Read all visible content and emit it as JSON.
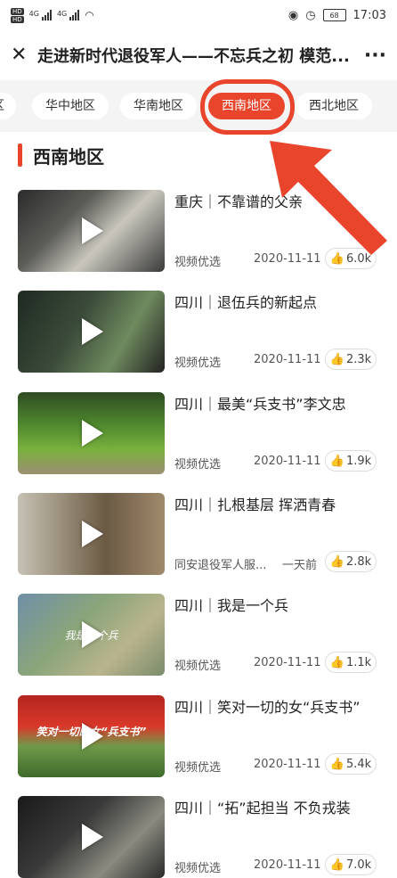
{
  "status_bar": {
    "time": "17:03",
    "battery": "68",
    "network1": "4G",
    "network2": "4G",
    "hd1": "HD",
    "hd2": "HD"
  },
  "header": {
    "title": "走进新时代退役军人——不忘兵之初 模范..."
  },
  "tabs": [
    {
      "label": "区"
    },
    {
      "label": "华中地区"
    },
    {
      "label": "华南地区"
    },
    {
      "label": "西南地区"
    },
    {
      "label": "西北地区"
    }
  ],
  "section": {
    "title": "西南地区"
  },
  "videos": [
    {
      "title": "重庆｜不靠谱的父亲",
      "source": "视频优选",
      "date": "2020-11-11",
      "likes": "6.0k"
    },
    {
      "title": "四川｜退伍兵的新起点",
      "source": "视频优选",
      "date": "2020-11-11",
      "likes": "2.3k"
    },
    {
      "title": "四川｜最美“兵支书”李文忠",
      "source": "视频优选",
      "date": "2020-11-11",
      "likes": "1.9k"
    },
    {
      "title": "四川｜扎根基层 挥洒青春",
      "source": "同安退役军人服...",
      "date": "一天前",
      "likes": "2.8k"
    },
    {
      "title": "四川｜我是一个兵",
      "source": "视频优选",
      "date": "2020-11-11",
      "likes": "1.1k",
      "overlay": "我是一个兵"
    },
    {
      "title": "四川｜笑对一切的女“兵支书”",
      "source": "视频优选",
      "date": "2020-11-11",
      "likes": "5.4k",
      "overlay": "笑对一切的女“兵支书”"
    },
    {
      "title": "四川｜“拓”起担当 不负戎装",
      "source": "视频优选",
      "date": "2020-11-11",
      "likes": "7.0k"
    }
  ],
  "colors": {
    "accent": "#e8452c",
    "tab_bg": "#f4f4f4"
  },
  "icons": {
    "close": "close-icon",
    "more": "more-icon",
    "play": "play-icon",
    "like": "thumbs-up-icon"
  }
}
